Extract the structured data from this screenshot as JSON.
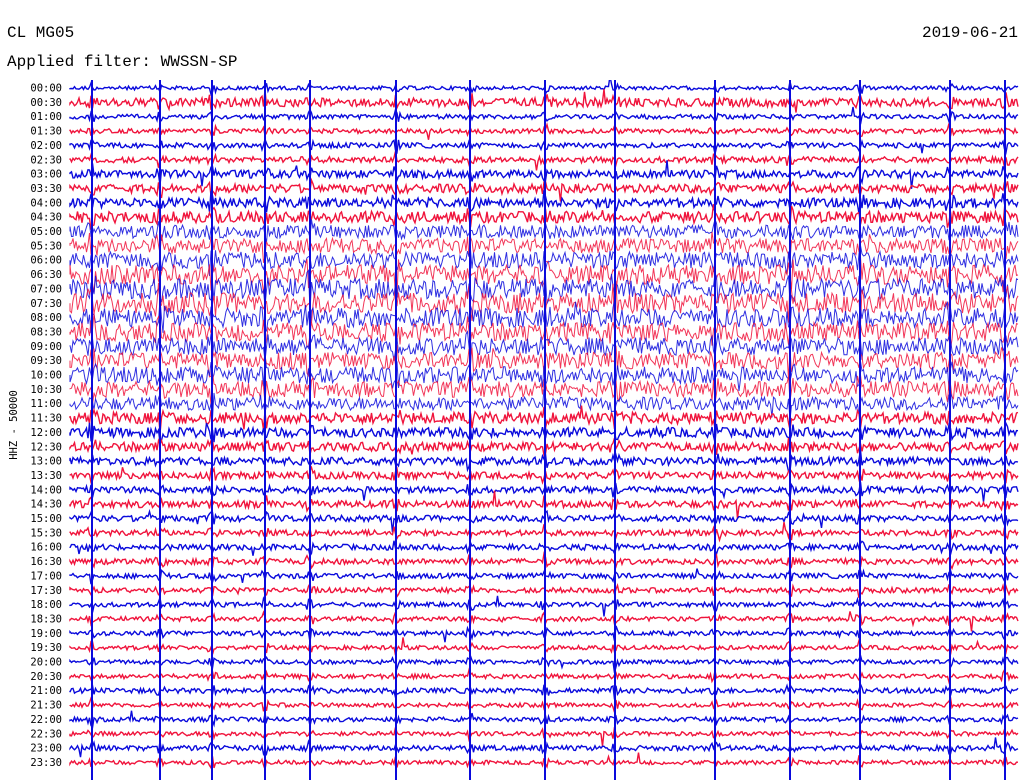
{
  "header": {
    "station": "CL MG05",
    "filter": "Applied filter: WWSSN-SP",
    "date": "2019-06-21"
  },
  "colors": {
    "even_trace": "#0a0adc",
    "odd_trace": "#f0143c",
    "background": "#ffffff",
    "text": "#000000"
  },
  "chart_data": {
    "type": "helicorder",
    "title": "",
    "ylabel": "HHZ - 50000",
    "xlabel": "",
    "grid": false,
    "legend": "none",
    "row_interval_minutes": 30,
    "rows": [
      {
        "label": "00:00",
        "activity": 0.08
      },
      {
        "label": "00:30",
        "activity": 0.35
      },
      {
        "label": "01:00",
        "activity": 0.12
      },
      {
        "label": "01:30",
        "activity": 0.12
      },
      {
        "label": "02:00",
        "activity": 0.15
      },
      {
        "label": "02:30",
        "activity": 0.2
      },
      {
        "label": "03:00",
        "activity": 0.3
      },
      {
        "label": "03:30",
        "activity": 0.35
      },
      {
        "label": "04:00",
        "activity": 0.4
      },
      {
        "label": "04:30",
        "activity": 0.5
      },
      {
        "label": "05:00",
        "activity": 0.6
      },
      {
        "label": "05:30",
        "activity": 0.7
      },
      {
        "label": "06:00",
        "activity": 0.8
      },
      {
        "label": "06:30",
        "activity": 0.95
      },
      {
        "label": "07:00",
        "activity": 1.0
      },
      {
        "label": "07:30",
        "activity": 1.0
      },
      {
        "label": "08:00",
        "activity": 0.95
      },
      {
        "label": "08:30",
        "activity": 0.9
      },
      {
        "label": "09:00",
        "activity": 0.85
      },
      {
        "label": "09:30",
        "activity": 0.8
      },
      {
        "label": "10:00",
        "activity": 0.8
      },
      {
        "label": "10:30",
        "activity": 0.75
      },
      {
        "label": "11:00",
        "activity": 0.6
      },
      {
        "label": "11:30",
        "activity": 0.5
      },
      {
        "label": "12:00",
        "activity": 0.4
      },
      {
        "label": "12:30",
        "activity": 0.35
      },
      {
        "label": "13:00",
        "activity": 0.3
      },
      {
        "label": "13:30",
        "activity": 0.25
      },
      {
        "label": "14:00",
        "activity": 0.22
      },
      {
        "label": "14:30",
        "activity": 0.25
      },
      {
        "label": "15:00",
        "activity": 0.2
      },
      {
        "label": "15:30",
        "activity": 0.18
      },
      {
        "label": "16:00",
        "activity": 0.18
      },
      {
        "label": "16:30",
        "activity": 0.18
      },
      {
        "label": "17:00",
        "activity": 0.15
      },
      {
        "label": "17:30",
        "activity": 0.15
      },
      {
        "label": "18:00",
        "activity": 0.12
      },
      {
        "label": "18:30",
        "activity": 0.12
      },
      {
        "label": "19:00",
        "activity": 0.12
      },
      {
        "label": "19:30",
        "activity": 0.1
      },
      {
        "label": "20:00",
        "activity": 0.1
      },
      {
        "label": "20:30",
        "activity": 0.12
      },
      {
        "label": "21:00",
        "activity": 0.15
      },
      {
        "label": "21:30",
        "activity": 0.1
      },
      {
        "label": "22:00",
        "activity": 0.12
      },
      {
        "label": "22:30",
        "activity": 0.1
      },
      {
        "label": "23:00",
        "activity": 0.15
      },
      {
        "label": "23:30",
        "activity": 0.1
      }
    ]
  }
}
